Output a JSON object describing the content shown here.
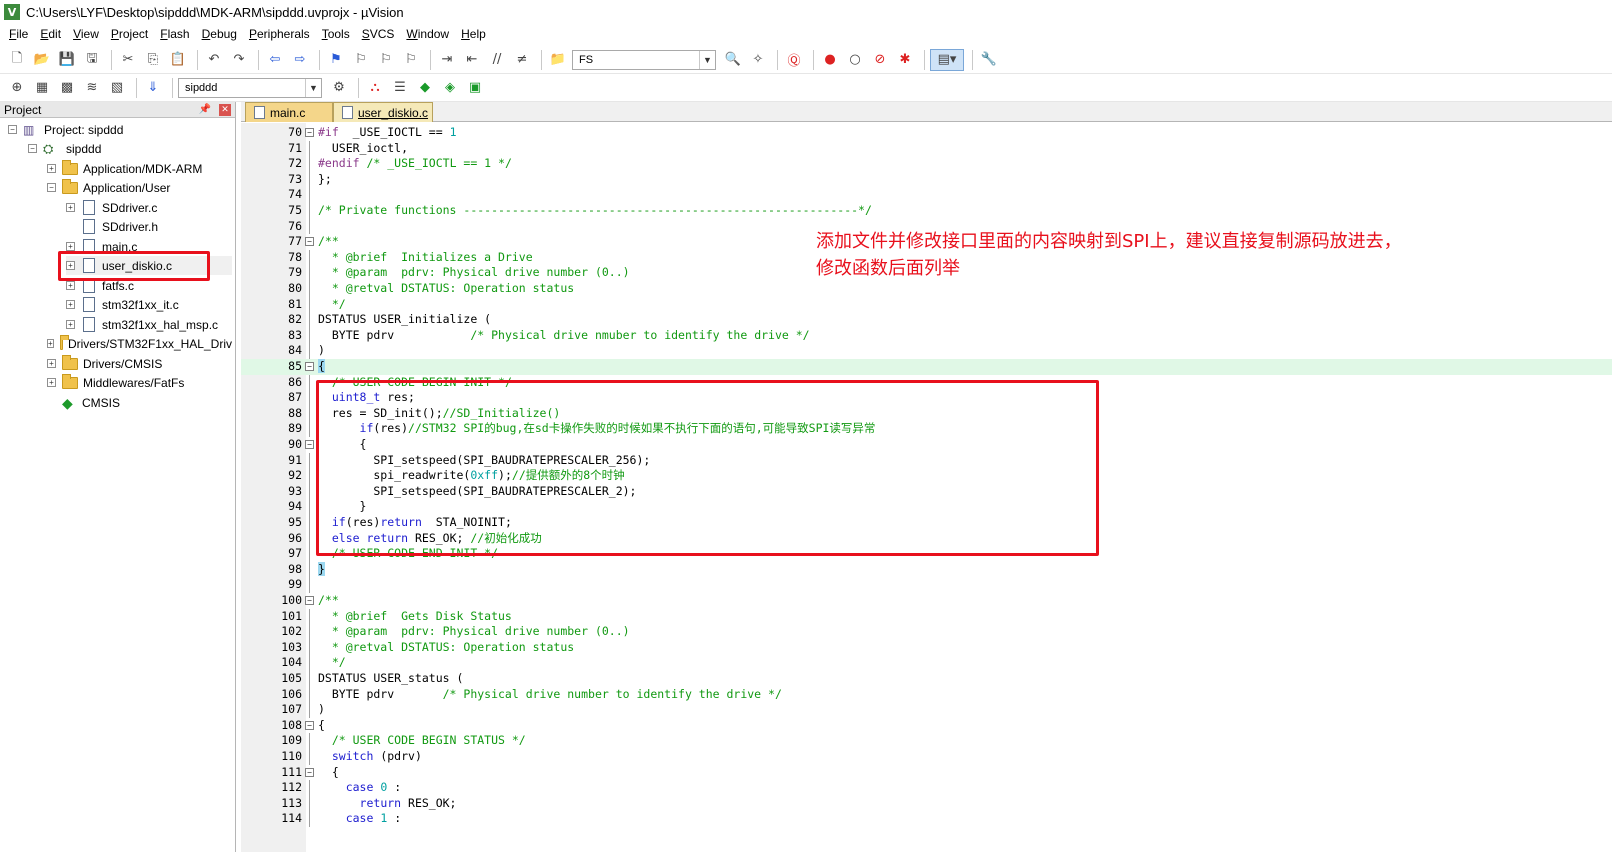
{
  "window": {
    "title": "C:\\Users\\LYF\\Desktop\\sipddd\\MDK-ARM\\sipddd.uvprojx - µVision",
    "app_icon": "V"
  },
  "menu": [
    "File",
    "Edit",
    "View",
    "Project",
    "Flash",
    "Debug",
    "Peripherals",
    "Tools",
    "SVCS",
    "Window",
    "Help"
  ],
  "toolbar1": {
    "find_value": "FS"
  },
  "toolbar2": {
    "target_value": "sipddd"
  },
  "project_panel": {
    "header": "Project",
    "tree": [
      {
        "label": "Project: sipddd",
        "toggle": "⊟",
        "kind": "root"
      },
      {
        "label": "sipddd",
        "toggle": "⊟",
        "kind": "target"
      },
      {
        "label": "Application/MDK-ARM",
        "toggle": "+",
        "kind": "folder"
      },
      {
        "label": "Application/User",
        "toggle": "−",
        "kind": "folder"
      },
      {
        "label": "SDdriver.c",
        "toggle": "+",
        "kind": "file"
      },
      {
        "label": "SDdriver.h",
        "toggle": "",
        "kind": "file"
      },
      {
        "label": "main.c",
        "toggle": "+",
        "kind": "file"
      },
      {
        "label": "user_diskio.c",
        "toggle": "+",
        "kind": "file"
      },
      {
        "label": "fatfs.c",
        "toggle": "+",
        "kind": "file"
      },
      {
        "label": "stm32f1xx_it.c",
        "toggle": "+",
        "kind": "file"
      },
      {
        "label": "stm32f1xx_hal_msp.c",
        "toggle": "+",
        "kind": "file"
      },
      {
        "label": "Drivers/STM32F1xx_HAL_Driv",
        "toggle": "+",
        "kind": "folder"
      },
      {
        "label": "Drivers/CMSIS",
        "toggle": "+",
        "kind": "folder"
      },
      {
        "label": "Middlewares/FatFs",
        "toggle": "+",
        "kind": "folder"
      },
      {
        "label": "CMSIS",
        "toggle": "",
        "kind": "component"
      }
    ]
  },
  "tabs": [
    {
      "label": "main.c",
      "active": false
    },
    {
      "label": "user_diskio.c",
      "active": true
    }
  ],
  "code": {
    "lines": [
      {
        "n": "70",
        "t": "#if  _USE_IOCTL == 1"
      },
      {
        "n": "71",
        "t": "  USER_ioctl,"
      },
      {
        "n": "72",
        "t": "#endif /* _USE_IOCTL == 1 */"
      },
      {
        "n": "73",
        "t": "};"
      },
      {
        "n": "74",
        "t": ""
      },
      {
        "n": "75",
        "t": "/* Private functions ---------------------------------------------------------*/"
      },
      {
        "n": "76",
        "t": ""
      },
      {
        "n": "77",
        "t": "/**"
      },
      {
        "n": "78",
        "t": "  * @brief  Initializes a Drive"
      },
      {
        "n": "79",
        "t": "  * @param  pdrv: Physical drive number (0..)"
      },
      {
        "n": "80",
        "t": "  * @retval DSTATUS: Operation status"
      },
      {
        "n": "81",
        "t": "  */"
      },
      {
        "n": "82",
        "t": "DSTATUS USER_initialize ("
      },
      {
        "n": "83",
        "t": "  BYTE pdrv           /* Physical drive nmuber to identify the drive */"
      },
      {
        "n": "84",
        "t": ")"
      },
      {
        "n": "85",
        "t": "{"
      },
      {
        "n": "86",
        "t": "  /* USER CODE BEGIN INIT */"
      },
      {
        "n": "87",
        "t": "  uint8_t res;"
      },
      {
        "n": "88",
        "t": "  res = SD_init();//SD_Initialize()"
      },
      {
        "n": "89",
        "t": "      if(res)//STM32 SPI的bug,在sd卡操作失败的时候如果不执行下面的语句,可能导致SPI读写异常"
      },
      {
        "n": "90",
        "t": "      {"
      },
      {
        "n": "91",
        "t": "        SPI_setspeed(SPI_BAUDRATEPRESCALER_256);"
      },
      {
        "n": "92",
        "t": "        spi_readwrite(0xff);//提供额外的8个时钟"
      },
      {
        "n": "93",
        "t": "        SPI_setspeed(SPI_BAUDRATEPRESCALER_2);"
      },
      {
        "n": "94",
        "t": "      }"
      },
      {
        "n": "95",
        "t": "  if(res)return  STA_NOINIT;"
      },
      {
        "n": "96",
        "t": "  else return RES_OK; //初始化成功"
      },
      {
        "n": "97",
        "t": "  /* USER CODE END INIT */"
      },
      {
        "n": "98",
        "t": "}"
      },
      {
        "n": "99",
        "t": ""
      },
      {
        "n": "100",
        "t": "/**"
      },
      {
        "n": "101",
        "t": "  * @brief  Gets Disk Status"
      },
      {
        "n": "102",
        "t": "  * @param  pdrv: Physical drive number (0..)"
      },
      {
        "n": "103",
        "t": "  * @retval DSTATUS: Operation status"
      },
      {
        "n": "104",
        "t": "  */"
      },
      {
        "n": "105",
        "t": "DSTATUS USER_status ("
      },
      {
        "n": "106",
        "t": "  BYTE pdrv       /* Physical drive number to identify the drive */"
      },
      {
        "n": "107",
        "t": ")"
      },
      {
        "n": "108",
        "t": "{"
      },
      {
        "n": "109",
        "t": "  /* USER CODE BEGIN STATUS */"
      },
      {
        "n": "110",
        "t": "  switch (pdrv)"
      },
      {
        "n": "111",
        "t": "  {"
      },
      {
        "n": "112",
        "t": "    case 0 :"
      },
      {
        "n": "113",
        "t": "      return RES_OK;"
      },
      {
        "n": "114",
        "t": "    case 1 :"
      }
    ]
  },
  "annotation": {
    "line1": "添加文件并修改接口里面的内容映射到SPI上，建议直接复制源码放进去，",
    "line2": "修改函数后面列举"
  },
  "colors": {
    "annotation_red": "#e8101c",
    "current_line": "#e0f8e6",
    "keyword": "#2020d0",
    "comment": "#119911"
  }
}
